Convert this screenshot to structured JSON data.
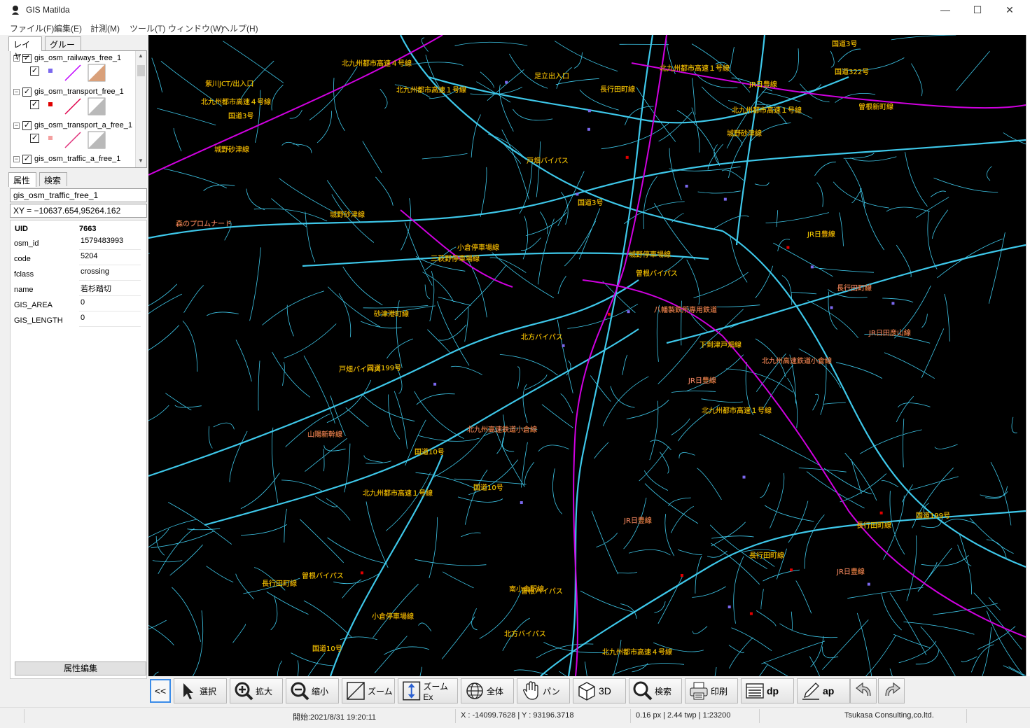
{
  "window": {
    "title": "GIS Matilda",
    "minimize": "—",
    "maximize": "☐",
    "close": "✕"
  },
  "menu": [
    "ファイル(F)",
    "編集(E)",
    "計測(M)",
    "ツール(T)",
    "ウィンドウ(W)",
    "ヘルプ(H)"
  ],
  "layer_tabs": {
    "layers": "レイヤー",
    "groups": "グループ"
  },
  "layers": [
    {
      "name": "gis_osm_railways_free_1",
      "checked": true,
      "point_color": "#7b68ee",
      "line_color": "#c000ff",
      "poly_color": "#d9a07a"
    },
    {
      "name": "gis_osm_transport_free_1",
      "checked": true,
      "point_color": "#e00000",
      "line_color": "#e0004a",
      "poly_color": "#b9b9b9"
    },
    {
      "name": "gis_osm_transport_a_free_1",
      "checked": true,
      "point_color": "#f4a0a0",
      "line_color": "#e0307a",
      "poly_color": "#b9b9b9"
    },
    {
      "name": "gis_osm_traffic_a_free_1",
      "checked": true
    }
  ],
  "props_tabs": {
    "attributes": "属性",
    "search": "検索"
  },
  "selected_layer": "gis_osm_traffic_free_1",
  "xy_readout": "XY = −10637.654,95264.162",
  "attributes": {
    "uid_label": "UID",
    "uid_value": "7663",
    "rows": [
      {
        "key": "osm_id",
        "value": "1579483993"
      },
      {
        "key": "code",
        "value": "5204"
      },
      {
        "key": "fclass",
        "value": "crossing"
      },
      {
        "key": "name",
        "value": "若杉踏切"
      },
      {
        "key": "GIS_AREA",
        "value": "0"
      },
      {
        "key": "GIS_LENGTH",
        "value": "0"
      }
    ]
  },
  "attr_edit_button": "属性編集",
  "toolbar": {
    "collapse": "<<",
    "buttons": [
      {
        "label": "選択",
        "icon": "cursor-arrow-icon"
      },
      {
        "label": "拡大",
        "icon": "zoom-in-icon"
      },
      {
        "label": "縮小",
        "icon": "zoom-out-icon"
      },
      {
        "label": "ズーム",
        "icon": "zoom-box-icon"
      },
      {
        "label": "ズームEx",
        "icon": "zoom-ex-icon"
      },
      {
        "label": "全体",
        "icon": "globe-icon"
      },
      {
        "label": "パン",
        "icon": "hand-pan-icon"
      },
      {
        "label": "3D",
        "icon": "cube-3d-icon"
      },
      {
        "label": "検索",
        "icon": "magnifier-icon"
      },
      {
        "label": "印刷",
        "icon": "printer-icon"
      },
      {
        "label": "dp",
        "icon": "display-props-icon"
      },
      {
        "label": "ap",
        "icon": "pen-edit-icon"
      },
      {
        "label": "",
        "icon": "undo-icon"
      },
      {
        "label": "",
        "icon": "redo-icon"
      }
    ]
  },
  "status": {
    "start": "開始:2021/8/31 19:20:11",
    "coords": "X : -14099.7628 | Y : 93196.3718",
    "scale": "0.16 px | 2.44 twp | 1:23200",
    "company": "Tsukasa Consulting,co.ltd."
  },
  "map": {
    "background": "#000000",
    "road_color": "#3ec8ea",
    "railway_color": "#d000e0",
    "label_color": "#ffff00",
    "label_outline": "#b35e00",
    "yellow_labels": [
      "国道199号",
      "北九州都市高速１号線",
      "長行田町線",
      "小倉停車場線",
      "国道3号",
      "北九州都市高速４号線",
      "小倉停車場線",
      "砂津港町線",
      "南小倉駅線",
      "北九州都市高速１号線",
      "長行田町線",
      "戸畑バイパス",
      "北九州都市高速１号線",
      "三萩野停車場線",
      "国道199号",
      "城野砂津線",
      "戸畑バイパス",
      "曽根バイパス",
      "北九州都市高速４号線",
      "下到津戸畑線",
      "国道3号",
      "足立出入口",
      "城野砂津線",
      "国道3号",
      "北九州都市高速１号線",
      "城野砂津線",
      "北九州都市高速１号線",
      "国道10号",
      "長行田町線",
      "曽根バイパス",
      "北方バイパス",
      "JR日豊線",
      "国道322号",
      "城野停車場線",
      "紫川JCT/出入口",
      "長行田町線",
      "曽根新町線",
      "北九州都市高速４号線",
      "国道10号",
      "曽根バイパス",
      "JR日豊線",
      "北方バイパス",
      "国道10号"
    ],
    "pink_labels": [
      "八幡製鉄所専用鉄道",
      "北九州高速鉄道小倉線",
      "JR日豊線",
      "山陽新幹線",
      "長行田町線",
      "北九州高速鉄道小倉線",
      "JR日田彦山線",
      "JR日豊線",
      "森のプロムナード",
      "JR日豊線"
    ]
  }
}
